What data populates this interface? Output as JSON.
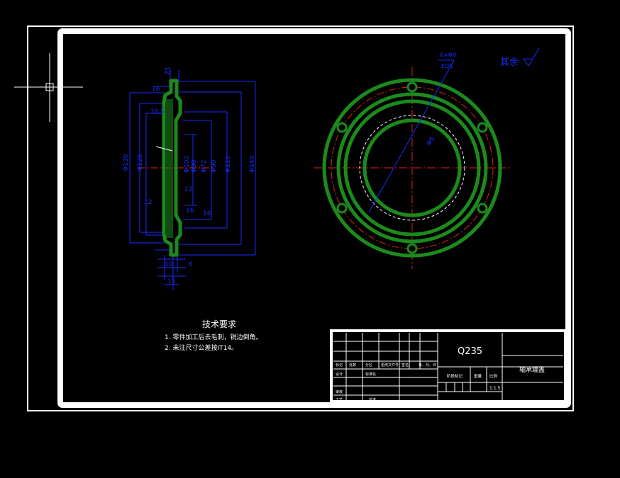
{
  "tech_requirements": {
    "title": "技术要求",
    "items": [
      "1. 零件加工后去毛刺，锐边倒角。",
      "2. 未注尺寸公差按IT14。"
    ]
  },
  "roughness_note": "其余",
  "title_block": {
    "material": "Q235",
    "part_name": "轴承端盖",
    "scale_header": "比例",
    "scale_value": "1:1.5",
    "weight_header": "重量",
    "stage_header": "阶段标记",
    "labels": [
      "标记",
      "处数",
      "分区",
      "更改文件号",
      "签名",
      "年、月、日",
      "设计",
      "标准化",
      "审核",
      "工艺",
      "批准"
    ]
  },
  "section_dimensions": {
    "top": [
      "12",
      "16",
      "10.5"
    ],
    "left": [
      "Φ130",
      "Φ120",
      "12"
    ],
    "middle": [
      "Φ100",
      "Φ90",
      "12",
      "16",
      "16"
    ],
    "right": [
      "Φ72",
      "Φ90",
      "Φ110",
      "Φ140"
    ],
    "bottom": [
      "6",
      "10",
      "15"
    ]
  },
  "view_dimensions": {
    "hole_note": "6×Φ8",
    "hole_sub": "EQS",
    "bore": "Φ5"
  },
  "colors": {
    "part": "#1c8a1c",
    "dimension": "#1a2cff",
    "center": "#e02020",
    "frame": "#ffffff"
  }
}
